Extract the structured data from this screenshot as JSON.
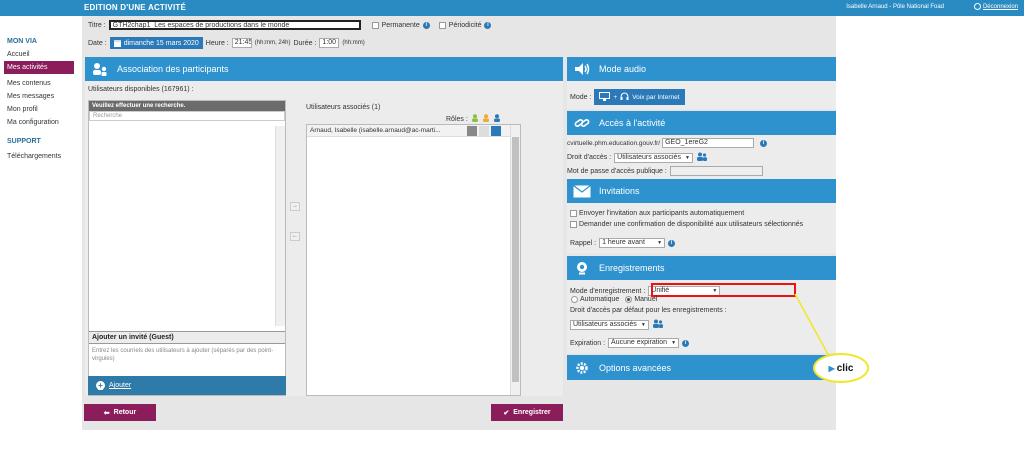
{
  "header": {
    "title": "EDITION D'UNE ACTIVITÉ",
    "user": "Isabelle Arnaud - Pôle National Foad",
    "logout": "Déconnexion"
  },
  "sidebar": {
    "section1": "MON VIA",
    "items": [
      "Accueil",
      "Mes activités",
      "Mes contenus",
      "Mes messages",
      "Mon profil",
      "Ma configuration"
    ],
    "section2": "SUPPORT",
    "support_items": [
      "Téléchargements"
    ]
  },
  "form": {
    "title_label": "Titre :",
    "title_value": "GTH2chap1_Les espaces de productions dans le monde",
    "permanent": "Permanente",
    "periodicity": "Périodicité",
    "date_label": "Date :",
    "date_value": "dimanche 15 mars 2020",
    "time_label": "Heure :",
    "time_value": "21:45",
    "time_hint": "(hh:mm, 24h)",
    "duration_label": "Durée :",
    "duration_value": "1:00",
    "duration_hint": "(hh:mm)"
  },
  "participants": {
    "header": "Association des participants",
    "available": "Utilisateurs disponibles (167961) :",
    "list_prompt": "Veuillez effectuer une recherche.",
    "search_placeholder": "Recherche",
    "associated": "Utilisateurs associés (1)",
    "roles": "Rôles :",
    "member": "Arnaud, Isabelle (isabelle.arnaud@ac-marti...",
    "guest_title": "Ajouter un invité (Guest)",
    "guest_help": "Entrez les courriels des utilisateurs à ajouter (séparés par des point-virgules)",
    "add_guest": "Ajouter"
  },
  "audio": {
    "header": "Mode audio",
    "label": "Mode :",
    "value": "Voix par Internet"
  },
  "access": {
    "header": "Accès à l'activité",
    "url_prefix": "cvirtuelle.phm.education.gouv.fr/",
    "url_value": "GEO_1ereG2",
    "rights_label": "Droit d'accès :",
    "rights_value": "Utilisateurs associés",
    "password_label": "Mot de passe d'accès publique :"
  },
  "invitations": {
    "header": "Invitations",
    "opt1": "Envoyer l'invitation aux participants automatiquement",
    "opt2": "Demander une confirmation de disponibilité aux utilisateurs sélectionnés",
    "reminder_label": "Rappel :",
    "reminder_value": "1 heure avant"
  },
  "recordings": {
    "header": "Enregistrements",
    "mode_label": "Mode d'enregistrement :",
    "mode_value": "Unifié",
    "auto": "Automatique",
    "manual": "Manuel",
    "default_rights_label": "Droit d'accès par défaut pour les enregistrements :",
    "default_rights_value": "Utilisateurs associés",
    "expiration_label": "Expiration :",
    "expiration_value": "Aucune expiration"
  },
  "advanced": {
    "header": "Options avancées",
    "annotation": "clic"
  },
  "buttons": {
    "back": "Retour",
    "save": "Enregistrer"
  }
}
